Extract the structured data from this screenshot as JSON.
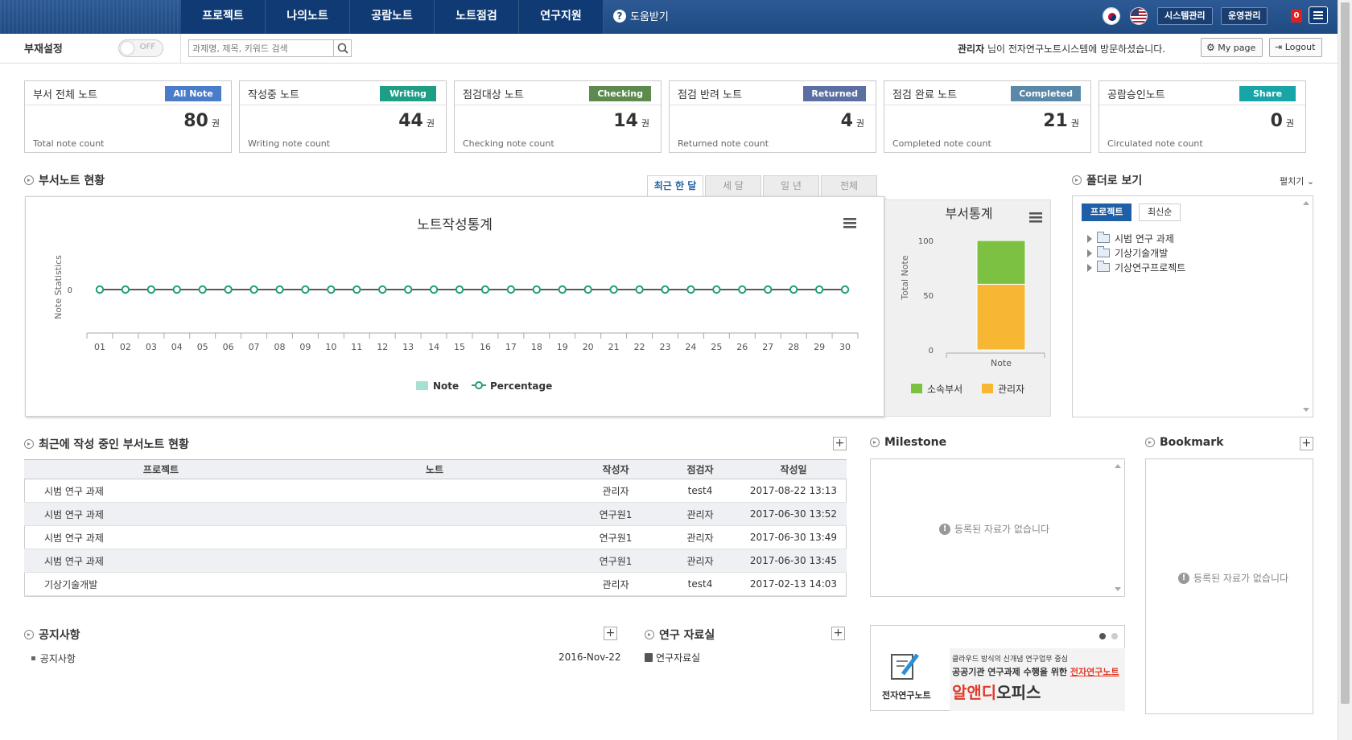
{
  "nav": {
    "menu": [
      "프로젝트",
      "나의노트",
      "공람노트",
      "노트점검",
      "연구지원"
    ],
    "help_label": "도움받기",
    "help_icon": "question-icon",
    "system_admin": "시스템관리",
    "operation_admin": "운영관리",
    "alert_count": "0",
    "menu_icon": "hamburger-icon"
  },
  "subbar": {
    "absence_label": "부재설정",
    "toggle_state": "OFF",
    "search_placeholder": "과제명, 제목, 키워드 검색",
    "welcome_user": "관리자",
    "welcome_text": " 님이 전자연구노트시스템에 방문하셨습니다.",
    "mypage_label": "My page",
    "logout_label": "Logout"
  },
  "cards": [
    {
      "title": "부서 전체 노트",
      "badge": "All Note",
      "badge_color": "#4a7cc9",
      "count": "80",
      "unit": "권",
      "footer": "Total note count"
    },
    {
      "title": "작성중 노트",
      "badge": "Writing",
      "badge_color": "#1f9e86",
      "count": "44",
      "unit": "권",
      "footer": "Writing note count"
    },
    {
      "title": "점검대상 노트",
      "badge": "Checking",
      "badge_color": "#5c8a4f",
      "count": "14",
      "unit": "권",
      "footer": "Checking note count"
    },
    {
      "title": "점검 반려 노트",
      "badge": "Returned",
      "badge_color": "#5b6fa3",
      "count": "4",
      "unit": "권",
      "footer": "Returned note count"
    },
    {
      "title": "점검 완료 노트",
      "badge": "Completed",
      "badge_color": "#5a88a8",
      "count": "21",
      "unit": "권",
      "footer": "Completed note count"
    },
    {
      "title": "공람승인노트",
      "badge": "Share",
      "badge_color": "#17a5a8",
      "count": "0",
      "unit": "권",
      "footer": "Circulated note count"
    }
  ],
  "dept_status": {
    "title": "부서노트 현황",
    "tabs": [
      "최근 한 달",
      "세 달",
      "일 년",
      "전체"
    ],
    "active_tab": 0
  },
  "chart_data": [
    {
      "type": "line",
      "title": "노트작성통계",
      "ylabel": "Note Statistics",
      "xlabel": "",
      "categories": [
        "01",
        "02",
        "03",
        "04",
        "05",
        "06",
        "07",
        "08",
        "09",
        "10",
        "11",
        "12",
        "13",
        "14",
        "15",
        "16",
        "17",
        "18",
        "19",
        "20",
        "21",
        "22",
        "23",
        "24",
        "25",
        "26",
        "27",
        "28",
        "29",
        "30"
      ],
      "series": [
        {
          "name": "Note",
          "kind": "bar",
          "color": "#a6e0d5",
          "values": [
            0,
            0,
            0,
            0,
            0,
            0,
            0,
            0,
            0,
            0,
            0,
            0,
            0,
            0,
            0,
            0,
            0,
            0,
            0,
            0,
            0,
            0,
            0,
            0,
            0,
            0,
            0,
            0,
            0,
            0
          ]
        },
        {
          "name": "Percentage",
          "kind": "line",
          "color": "#1f9e74",
          "values": [
            0,
            0,
            0,
            0,
            0,
            0,
            0,
            0,
            0,
            0,
            0,
            0,
            0,
            0,
            0,
            0,
            0,
            0,
            0,
            0,
            0,
            0,
            0,
            0,
            0,
            0,
            0,
            0,
            0,
            0
          ]
        }
      ],
      "yticks": [
        "0"
      ],
      "legend": "bottom"
    },
    {
      "type": "bar",
      "stacked": true,
      "title": "부서통계",
      "ylabel": "Total Note",
      "categories": [
        "Note"
      ],
      "series": [
        {
          "name": "소속부서",
          "color": "#7dc142",
          "values": [
            40
          ]
        },
        {
          "name": "관리자",
          "color": "#f7b733",
          "values": [
            60
          ]
        }
      ],
      "ylim": [
        0,
        100
      ],
      "yticks": [
        "0",
        "50",
        "100"
      ],
      "legend": "bottom"
    }
  ],
  "folder": {
    "title": "폴더로 보기",
    "expand_label": "펼치기",
    "tabs": [
      "프로젝트",
      "최신순"
    ],
    "items": [
      "시범 연구 과제",
      "기상기술개발",
      "기상연구프로젝트"
    ]
  },
  "recent": {
    "title": "최근에 작성 중인 부서노트 현황",
    "columns": [
      "프로젝트",
      "노트",
      "작성자",
      "점검자",
      "작성일"
    ],
    "rows": [
      [
        "시범 연구 과제",
        "",
        "관리자",
        "test4",
        "2017-08-22 13:13"
      ],
      [
        "시범 연구 과제",
        "",
        "연구원1",
        "관리자",
        "2017-06-30 13:52"
      ],
      [
        "시범 연구 과제",
        "",
        "연구원1",
        "관리자",
        "2017-06-30 13:49"
      ],
      [
        "시범 연구 과제",
        "",
        "연구원1",
        "관리자",
        "2017-06-30 13:45"
      ],
      [
        "기상기술개발",
        "",
        "관리자",
        "test4",
        "2017-02-13 14:03"
      ]
    ]
  },
  "milestone": {
    "title": "Milestone",
    "empty": "등록된 자료가 없습니다"
  },
  "bookmark": {
    "title": "Bookmark",
    "empty": "등록된 자료가 없습니다"
  },
  "notice": {
    "title": "공지사항",
    "item": "공지사항",
    "date": "2016-Nov-22"
  },
  "library": {
    "title": "연구 자료실",
    "item": "연구자료실"
  },
  "banner": {
    "logo_label": "전자연구노트",
    "line1": "클라우드 방식의 신개념 연구업무 중심",
    "line2_a": "공공기관 연구과제 수행을 위한 ",
    "line2_b": "전자연구노트",
    "brand_a": "알앤디",
    "brand_b": "오피스"
  }
}
